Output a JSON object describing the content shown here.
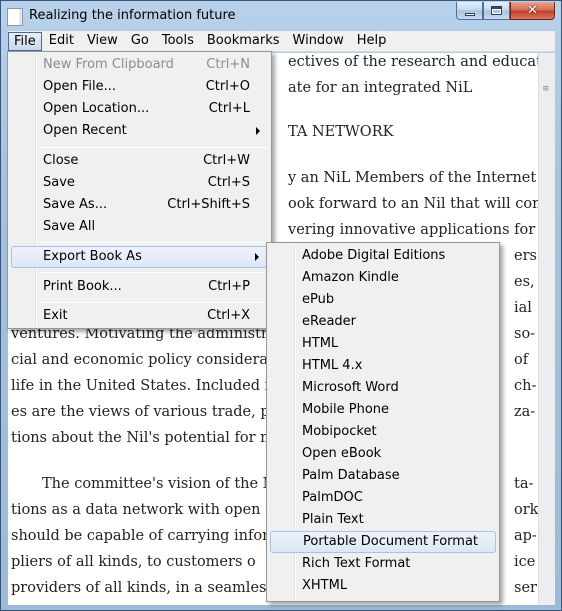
{
  "window": {
    "title": "Realizing the information future"
  },
  "menubar": {
    "items": [
      "File",
      "Edit",
      "View",
      "Go",
      "Tools",
      "Bookmarks",
      "Window",
      "Help"
    ]
  },
  "document": {
    "lines": [
      "ectives of the research and education",
      "ate for an integrated NiL",
      "TA NETWORK",
      "y an NiL Members of the Internet net-",
      "ook forward to an Nil that will contin-",
      "vering innovative applications for in-",
      "ers",
      "es,",
      "ial",
      "ventures. Motivating the administrati",
      "so-",
      "cial and economic policy consideratio",
      "of",
      "life in the United States. Included in t",
      "ch-",
      "es are the views of various trade, publ",
      "za-",
      "tions about the Nil's potential for me",
      "The committee's vision of the Nil",
      "ta-",
      "tions as a data network with open and",
      "ork",
      "should be capable of carrying inform",
      "ap-",
      "pliers of all kinds, to customers o",
      "ice",
      "providers of all kinds, in a seamless",
      "ser"
    ]
  },
  "file_menu": {
    "items": [
      {
        "label": "New From Clipboard",
        "shortcut": "Ctrl+N",
        "disabled": true
      },
      {
        "label": "Open File...",
        "shortcut": "Ctrl+O"
      },
      {
        "label": "Open Location...",
        "shortcut": "Ctrl+L"
      },
      {
        "label": "Open Recent",
        "shortcut": "",
        "submenu": true
      },
      {
        "label": "Close",
        "shortcut": "Ctrl+W"
      },
      {
        "label": "Save",
        "shortcut": "Ctrl+S"
      },
      {
        "label": "Save As...",
        "shortcut": "Ctrl+Shift+S"
      },
      {
        "label": "Save All",
        "shortcut": ""
      },
      {
        "label": "Export Book As",
        "shortcut": "",
        "submenu": true,
        "highlighted": true
      },
      {
        "label": "Print Book...",
        "shortcut": "Ctrl+P"
      },
      {
        "label": "Exit",
        "shortcut": "Ctrl+X"
      }
    ]
  },
  "export_menu": {
    "items": [
      "Adobe Digital Editions",
      "Amazon Kindle",
      "ePub",
      "eReader",
      "HTML",
      "HTML 4.x",
      "Microsoft Word",
      "Mobile Phone",
      "Mobipocket",
      "Open eBook",
      "Palm Database",
      "PalmDOC",
      "Plain Text",
      "Portable Document Format",
      "Rich Text Format",
      "XHTML"
    ],
    "highlighted": "Portable Document Format"
  },
  "colors": {
    "highlight_border": "#a8c2e6",
    "menu_bg": "#f0f0f0",
    "titlebar": "#b9d1ea"
  }
}
